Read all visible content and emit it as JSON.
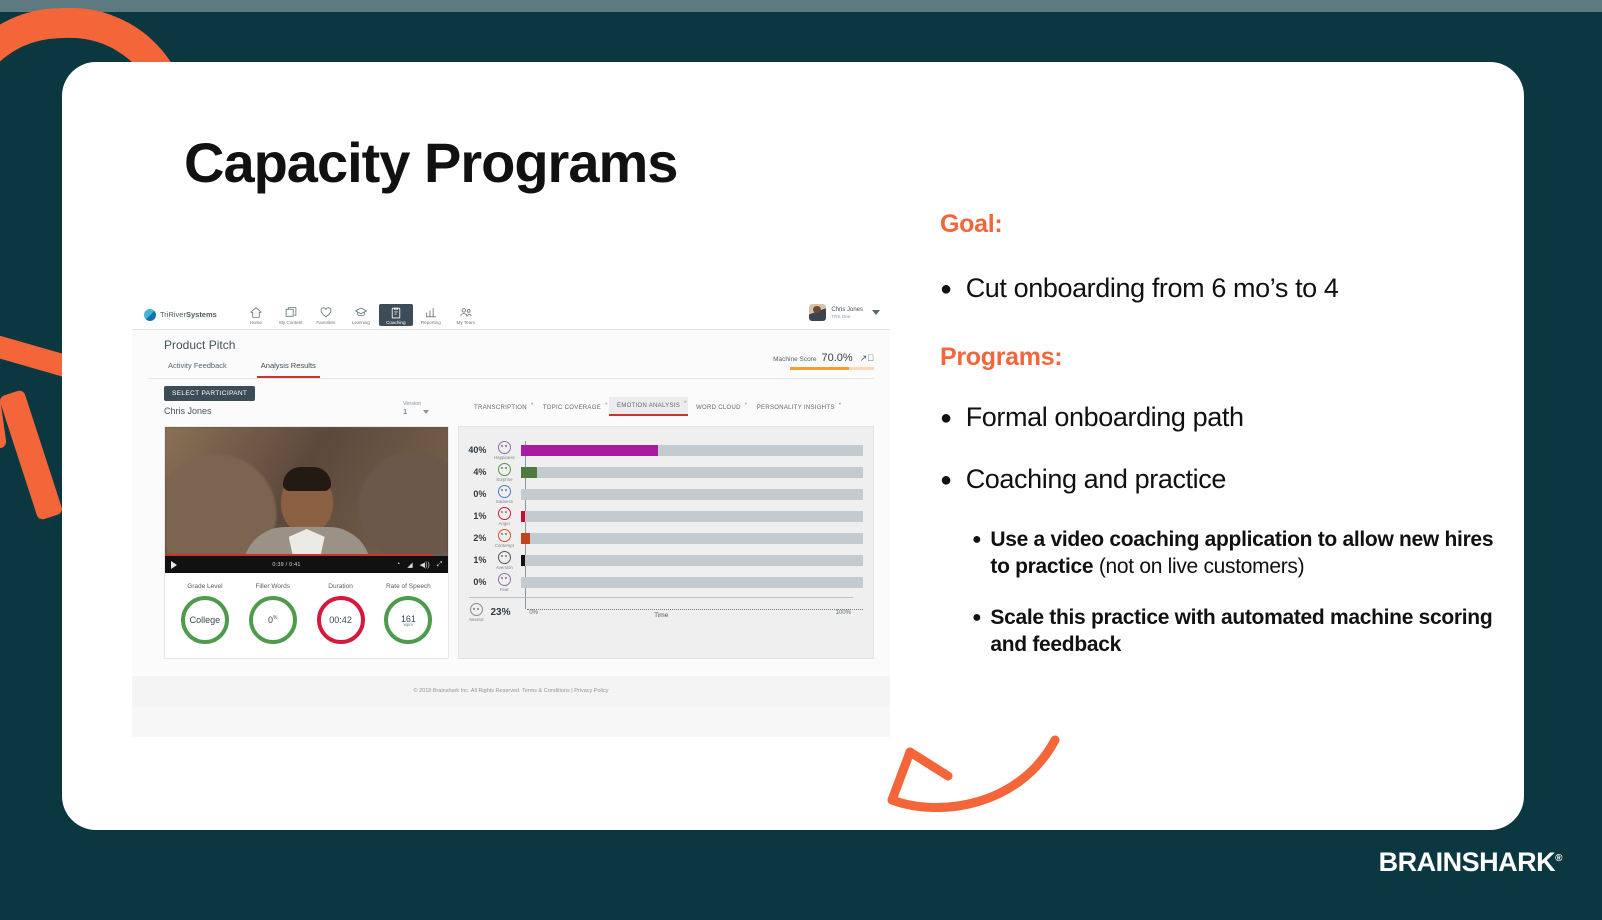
{
  "slide": {
    "title": "Capacity Programs",
    "brand_logo": "BRAINSHARK",
    "brand_tm": "®"
  },
  "right_column": {
    "goal_header": "Goal:",
    "goal_bullets": [
      {
        "dot": "●",
        "text": "Cut onboarding from 6 mo’s to 4"
      }
    ],
    "programs_header": "Programs:",
    "program_bullets": [
      {
        "dot": "●",
        "text": "Formal onboarding path"
      },
      {
        "dot": "●",
        "text": "Coaching and practice"
      }
    ],
    "sub_bullets": [
      {
        "dot": "●",
        "bold": "Use a video coaching application to allow new hires to practice",
        "light": " (not on live customers)"
      },
      {
        "dot": "●",
        "bold": "Scale this practice with automated machine scoring and feedback",
        "light": ""
      }
    ]
  },
  "app": {
    "brand_prefix": "TriRiver",
    "brand_suffix": "Systems",
    "nav_items": [
      {
        "label": "Home",
        "icon": "home-icon"
      },
      {
        "label": "My Content",
        "icon": "content-icon"
      },
      {
        "label": "Favorites",
        "icon": "heart-icon"
      },
      {
        "label": "Learning",
        "icon": "graduation-cap-icon"
      },
      {
        "label": "Coaching",
        "icon": "clipboard-icon"
      },
      {
        "label": "Reporting",
        "icon": "bar-chart-icon"
      },
      {
        "label": "My Team",
        "icon": "people-icon"
      }
    ],
    "active_nav": "Coaching",
    "user": {
      "name": "Chris Jones",
      "org": "TRS One"
    },
    "page_title": "Product Pitch",
    "tabs": [
      {
        "label": "Activity Feedback",
        "active": false
      },
      {
        "label": "Analysis Results",
        "active": true
      }
    ],
    "machine_score": {
      "label": "Machine Score",
      "value": "70.0%",
      "fill_percent": 70
    },
    "select_participant_button": "SELECT PARTICIPANT",
    "participant_name": "Chris Jones",
    "version": {
      "label": "Version",
      "value": "1"
    },
    "analysis_tabs": [
      {
        "label": "TRANSCRIPTION",
        "active": false
      },
      {
        "label": "TOPIC COVERAGE",
        "active": false
      },
      {
        "label": "EMOTION ANALYSIS",
        "active": true
      },
      {
        "label": "WORD CLOUD",
        "active": false
      },
      {
        "label": "PERSONALITY INSIGHTS",
        "active": false
      }
    ],
    "video": {
      "time": "0:39 / 0:41",
      "progress_percent": 95
    },
    "metrics": [
      {
        "label": "Grade Level",
        "value": "College",
        "sup": "",
        "unit": "",
        "ring": "green"
      },
      {
        "label": "Filler Words",
        "value": "0",
        "sup": "%",
        "unit": "",
        "ring": "green"
      },
      {
        "label": "Duration",
        "value": "00:42",
        "sup": "",
        "unit": "",
        "ring": "red"
      },
      {
        "label": "Rate of Speech",
        "value": "161",
        "sup": "",
        "unit": "wpm",
        "ring": "green"
      }
    ],
    "footer": "© 2018 Brainshark Inc. All Rights Reserved. Terms & Conditions | Privacy Policy"
  },
  "chart_data": {
    "type": "bar",
    "title": "Emotion Analysis",
    "xlabel": "Time",
    "ylabel": "",
    "xlim": [
      0,
      100
    ],
    "x_tick_labels": [
      "0%",
      "100%"
    ],
    "grid": false,
    "orientation": "horizontal",
    "categories": [
      "Happiness",
      "Surprise",
      "Sadness",
      "Anger",
      "Contempt",
      "Aversion",
      "Fear"
    ],
    "values": [
      40,
      4,
      0,
      1,
      2,
      1,
      0
    ],
    "value_labels": [
      "40%",
      "4%",
      "0%",
      "1%",
      "2%",
      "1%",
      "0%"
    ],
    "colors": [
      "#a81ca0",
      "#4f7a3e",
      "#4a7cc4",
      "#cf0b2d",
      "#c0441d",
      "#121212",
      "#8f6fb0"
    ],
    "track_color": "#c3cad0",
    "summary": {
      "label": "Neutral",
      "value": "23%"
    }
  },
  "colors": {
    "background": "#0b3740",
    "top_band": "#5c7a80",
    "accent_orange": "#f4663a",
    "card": "#ffffff",
    "text": "#111111"
  }
}
